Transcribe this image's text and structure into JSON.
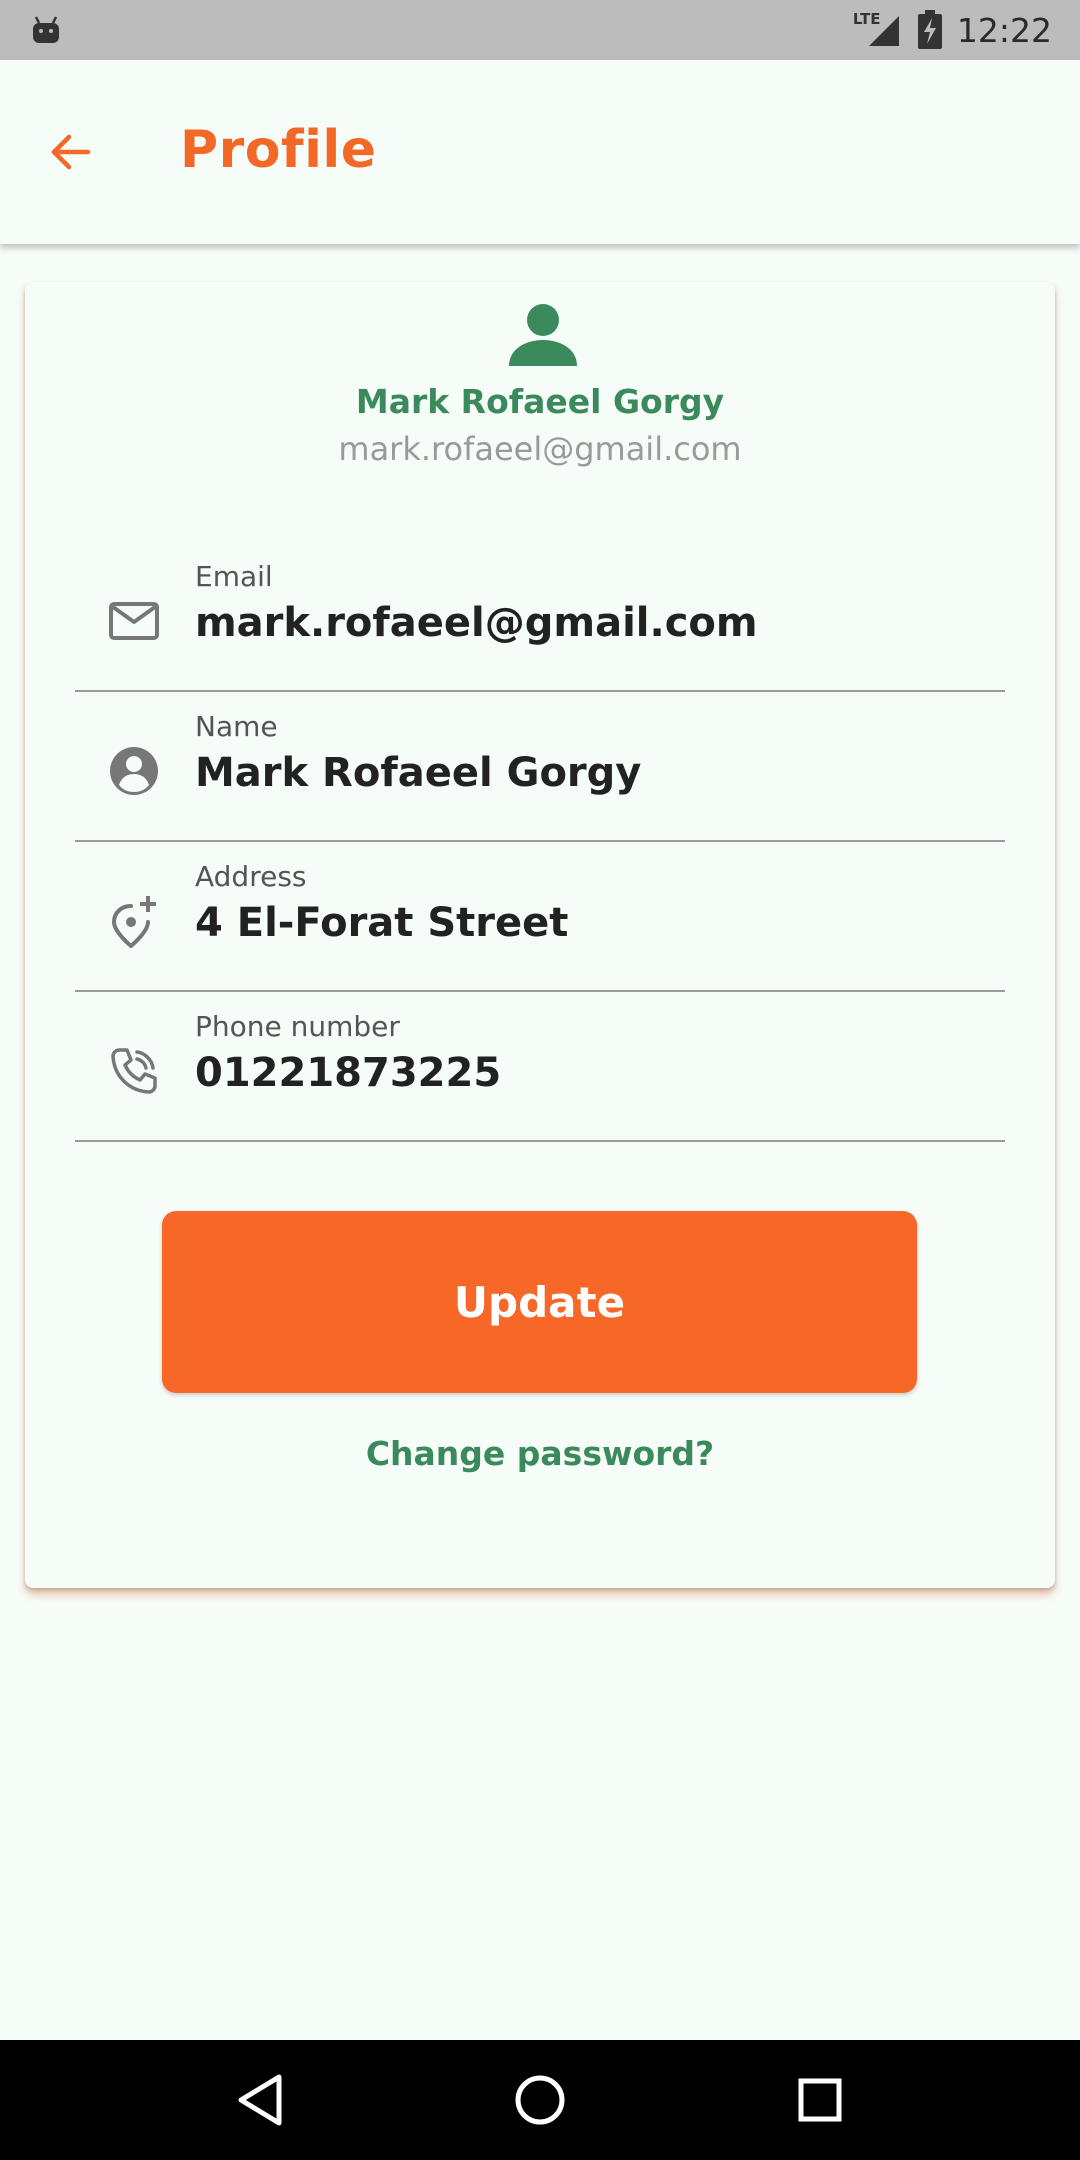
{
  "status_bar": {
    "time": "12:22",
    "network": "LTE"
  },
  "app_bar": {
    "title": "Profile",
    "back_icon": "arrow-left-icon"
  },
  "profile": {
    "avatar_icon": "person-icon",
    "name": "Mark Rofaeel Gorgy",
    "email": "mark.rofaeel@gmail.com"
  },
  "fields": [
    {
      "label": "Email",
      "value": "mark.rofaeel@gmail.com",
      "icon": "mail-icon"
    },
    {
      "label": "Name",
      "value": "Mark Rofaeel Gorgy",
      "icon": "account-circle-icon"
    },
    {
      "label": "Address",
      "value": "4 El-Forat Street",
      "icon": "add-location-icon"
    },
    {
      "label": "Phone number",
      "value": "01221873225",
      "icon": "phone-icon"
    }
  ],
  "actions": {
    "update_label": "Update",
    "change_password_label": "Change password?"
  },
  "colors": {
    "accent": "#f26827",
    "green": "#3a8a5c",
    "background": "#f6fcf8"
  }
}
